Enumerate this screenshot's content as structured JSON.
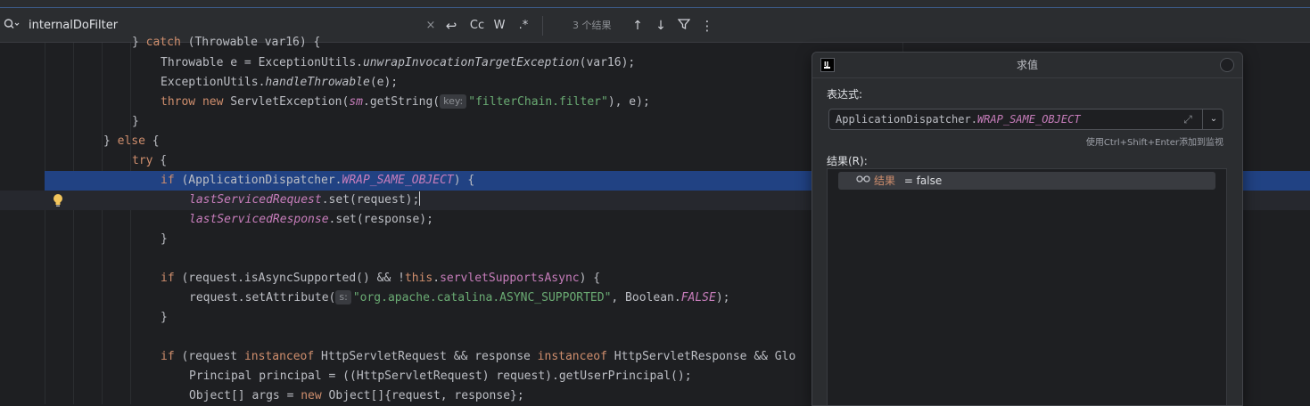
{
  "search": {
    "query": "internalDoFilter",
    "close_glyph": "×",
    "replace_toggle": "↩",
    "match_case": "Cc",
    "whole_word": "W",
    "regex": ".*",
    "result_count": "3 个结果",
    "prev_glyph": "↑",
    "next_glyph": "↓",
    "filter_glyph": "⛉",
    "more_glyph": "⋮"
  },
  "code": {
    "l0": {
      "a": "} ",
      "kw1": "catch",
      "b": " (Throwable var16) {"
    },
    "l1": {
      "a": "Throwable e = ExceptionUtils.",
      "fn": "unwrapInvocationTargetException",
      "b": "(var16);"
    },
    "l2": {
      "a": "ExceptionUtils.",
      "fn": "handleThrowable",
      "b": "(e);"
    },
    "l3": {
      "kw1": "throw",
      "sp1": " ",
      "kw2": "new",
      "a": " ServletException(",
      "fld": "sm",
      "b": ".getString(",
      "hint": "key:",
      "str": "\"filterChain.filter\"",
      "c": "), e);"
    },
    "l4": {
      "a": "}"
    },
    "l5": {
      "a": "} ",
      "kw1": "else",
      "b": " {"
    },
    "l6": {
      "kw1": "try",
      "a": " {"
    },
    "l7": {
      "kw1": "if",
      "a": " (ApplicationDispatcher.",
      "fld": "WRAP_SAME_OBJECT",
      "b": ") {"
    },
    "l8": {
      "fld": "lastServicedRequest",
      "a": ".set(request);"
    },
    "l9": {
      "fld": "lastServicedResponse",
      "a": ".set(response);"
    },
    "l10": {
      "a": "}"
    },
    "l12": {
      "kw1": "if",
      "a": " (request.isAsyncSupported() && !",
      "kw2": "this",
      "b": ".",
      "fld": "servletSupportsAsync",
      "c": ") {"
    },
    "l13": {
      "a": "request.setAttribute(",
      "hint": "s:",
      "str": "\"org.apache.catalina.ASYNC_SUPPORTED\"",
      "b": ", Boolean.",
      "fld": "FALSE",
      "c": ");"
    },
    "l14": {
      "a": "}"
    },
    "l16": {
      "kw1": "if",
      "a": " (request ",
      "kw2": "instanceof",
      "b": " HttpServletRequest && response ",
      "kw3": "instanceof",
      "c": " HttpServletResponse && Glo"
    },
    "l17": {
      "a": "Principal principal = ((HttpServletRequest) request).getUserPrincipal();"
    },
    "l18": {
      "a": "Object[] args = ",
      "kw1": "new",
      "b": " Object[]{request, response};"
    }
  },
  "popup": {
    "title": "求值",
    "expression_label": "表达式:",
    "expression_prefix": "ApplicationDispatcher.",
    "expression_field": "WRAP_SAME_OBJECT",
    "expand_glyph": "⤢",
    "dropdown_glyph": "⌄",
    "watch_hint": "使用Ctrl+Shift+Enter添加到监视",
    "result_label": "结果(R):",
    "result_name": "结果",
    "result_value": " = false"
  }
}
